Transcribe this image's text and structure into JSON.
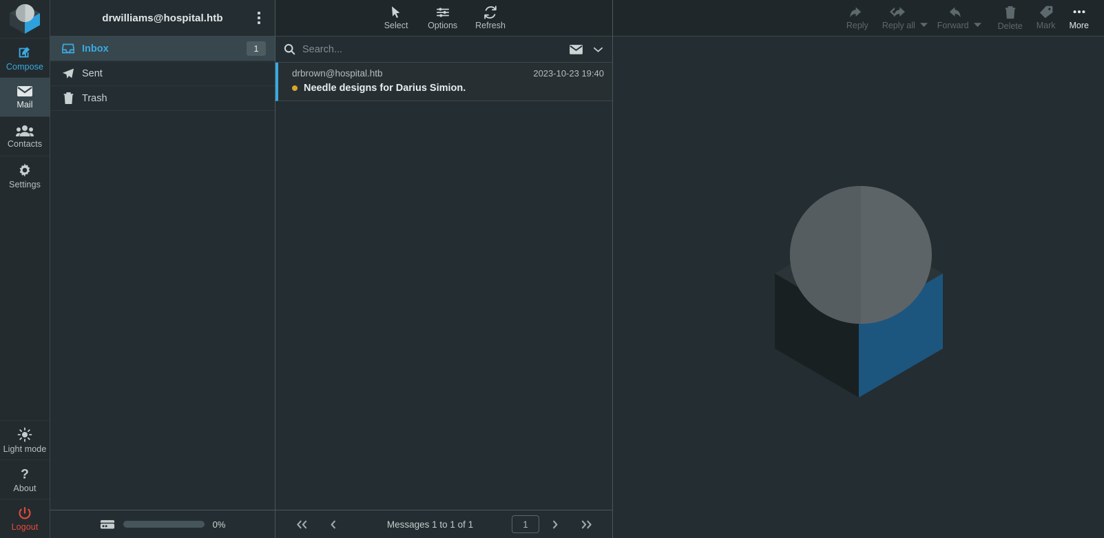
{
  "app": {
    "name": "Roundcube Webmail",
    "logo_name": "roundcube-logo",
    "theme": "dark",
    "accent_color": "#3aa9e0",
    "unread_dot_color": "#d9a52a",
    "logout_color": "#e64a3b"
  },
  "taskbar": {
    "items": [
      {
        "id": "compose",
        "label": "Compose",
        "icon": "compose-pencil-icon",
        "state": "accent"
      },
      {
        "id": "mail",
        "label": "Mail",
        "icon": "envelope-icon",
        "state": "selected"
      },
      {
        "id": "contacts",
        "label": "Contacts",
        "icon": "people-icon",
        "state": "normal"
      },
      {
        "id": "settings",
        "label": "Settings",
        "icon": "gear-icon",
        "state": "normal"
      }
    ],
    "bottom_items": [
      {
        "id": "lightmode",
        "label": "Light mode",
        "icon": "sun-icon",
        "state": "normal"
      },
      {
        "id": "about",
        "label": "About",
        "icon": "question-icon",
        "state": "normal"
      },
      {
        "id": "logout",
        "label": "Logout",
        "icon": "power-icon",
        "state": "danger"
      }
    ]
  },
  "folders": {
    "header": {
      "username": "drwilliams@hospital.htb",
      "menu_icon": "kebab-menu-icon"
    },
    "items": [
      {
        "id": "inbox",
        "label": "Inbox",
        "icon": "inbox-icon",
        "badge": "1",
        "selected": true
      },
      {
        "id": "sent",
        "label": "Sent",
        "icon": "send-icon",
        "badge": "",
        "selected": false
      },
      {
        "id": "trash",
        "label": "Trash",
        "icon": "trash-icon",
        "badge": "",
        "selected": false
      }
    ],
    "footer": {
      "icon": "disk-quota-icon",
      "quota_percent": "0%",
      "quota_fill": 0
    }
  },
  "list_toolbar": {
    "buttons": [
      {
        "id": "select",
        "label": "Select",
        "icon": "cursor-arrow-icon"
      },
      {
        "id": "options",
        "label": "Options",
        "icon": "sliders-icon"
      },
      {
        "id": "refresh",
        "label": "Refresh",
        "icon": "refresh-icon"
      }
    ]
  },
  "search": {
    "placeholder": "Search...",
    "value": "",
    "search_icon": "search-icon",
    "scope_icon": "envelope-icon",
    "dropdown_icon": "chevron-down-icon"
  },
  "messages": {
    "rows": [
      {
        "from": "drbrown@hospital.htb",
        "date": "2023-10-23 19:40",
        "subject": "Needle designs for Darius Simion.",
        "unread": true,
        "selected": true
      }
    ]
  },
  "list_footer": {
    "first_page_icon": "double-chevron-left-icon",
    "prev_page_icon": "chevron-left-icon",
    "status": "Messages 1 to 1 of 1",
    "page_value": "1",
    "next_page_icon": "chevron-right-icon",
    "last_page_icon": "double-chevron-right-icon"
  },
  "content_toolbar": {
    "buttons": [
      {
        "id": "reply",
        "label": "Reply",
        "icon": "reply-icon",
        "enabled": false,
        "caret": false
      },
      {
        "id": "replyall",
        "label": "Reply all",
        "icon": "reply-all-icon",
        "enabled": false,
        "caret": true
      },
      {
        "id": "forward",
        "label": "Forward",
        "icon": "forward-icon",
        "enabled": false,
        "caret": true
      },
      {
        "id": "delete",
        "label": "Delete",
        "icon": "trash-icon",
        "enabled": false,
        "caret": false
      },
      {
        "id": "mark",
        "label": "Mark",
        "icon": "tag-icon",
        "enabled": false,
        "caret": false
      },
      {
        "id": "more",
        "label": "More",
        "icon": "ellipsis-icon",
        "enabled": true,
        "caret": false
      }
    ]
  },
  "content_body": {
    "watermark_icon": "roundcube-logo-watermark",
    "message": ""
  }
}
